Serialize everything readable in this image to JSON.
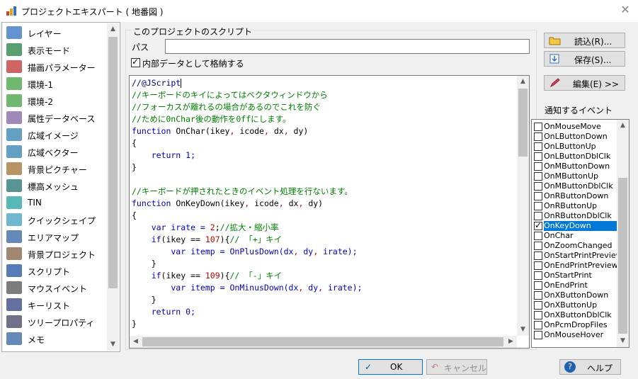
{
  "window": {
    "title": "プロジェクトエキスパート ( 地番図 )",
    "close_glyph": "✕"
  },
  "sidebar": {
    "items": [
      {
        "label": "レイヤー",
        "icon": "layer-icon"
      },
      {
        "label": "表示モード",
        "icon": "display-mode-icon"
      },
      {
        "label": "描画パラメーター",
        "icon": "draw-param-icon"
      },
      {
        "label": "環境-1",
        "icon": "env-icon"
      },
      {
        "label": "環境-2",
        "icon": "env-icon"
      },
      {
        "label": "属性データベース",
        "icon": "attr-db-icon"
      },
      {
        "label": "広域イメージ",
        "icon": "wide-image-icon"
      },
      {
        "label": "広域ベクター",
        "icon": "wide-vector-icon"
      },
      {
        "label": "背景ピクチャー",
        "icon": "bg-picture-icon"
      },
      {
        "label": "標高メッシュ",
        "icon": "elevation-mesh-icon"
      },
      {
        "label": "TIN",
        "icon": "tin-icon"
      },
      {
        "label": "クイックシェイプ",
        "icon": "quick-shape-icon"
      },
      {
        "label": "エリアマップ",
        "icon": "area-map-icon"
      },
      {
        "label": "背景プロジェクト",
        "icon": "bg-project-icon"
      },
      {
        "label": "スクリプト",
        "icon": "script-icon"
      },
      {
        "label": "マウスイベント",
        "icon": "mouse-icon"
      },
      {
        "label": "キーリスト",
        "icon": "key-list-icon"
      },
      {
        "label": "ツリープロパティ",
        "icon": "tree-prop-icon"
      },
      {
        "label": "メモ",
        "icon": "memo-icon"
      }
    ],
    "selected_index": 14
  },
  "script_group": {
    "title": "このプロジェクトのスクリプト",
    "path_label": "パス",
    "path_value": "",
    "store_internal_label": "内部データとして格納する",
    "store_internal_checked": true
  },
  "code_lines": [
    [
      {
        "t": "//@JScript",
        "c": "dark"
      },
      {
        "t": "",
        "c": "caret"
      }
    ],
    [
      {
        "t": "//キーボードのキイによってはベクタウィンドウから",
        "c": "green"
      }
    ],
    [
      {
        "t": "//フォーカスが離れるの場合があるのでこれを防ぐ",
        "c": "green"
      }
    ],
    [
      {
        "t": "//ために0nChar後の動作を0ffにします。",
        "c": "green"
      }
    ],
    [
      {
        "t": "function",
        "c": "blue"
      },
      {
        "t": " OnChar(ikey",
        "c": "black"
      },
      {
        "t": ",",
        "c": "red"
      },
      {
        "t": " icode",
        "c": "black"
      },
      {
        "t": ",",
        "c": "red"
      },
      {
        "t": " dx",
        "c": "black"
      },
      {
        "t": ",",
        "c": "red"
      },
      {
        "t": " dy)",
        "c": "black"
      }
    ],
    [
      {
        "t": "{",
        "c": "black"
      }
    ],
    [
      {
        "t": "    return 1;",
        "c": "blue"
      }
    ],
    [
      {
        "t": "}",
        "c": "black"
      }
    ],
    [
      {
        "t": "",
        "c": "black"
      }
    ],
    [
      {
        "t": "//キーボードが押されたときのイベント処理を行ないます。",
        "c": "green"
      }
    ],
    [
      {
        "t": "function",
        "c": "blue"
      },
      {
        "t": " OnKeyDown(ikey",
        "c": "black"
      },
      {
        "t": ",",
        "c": "red"
      },
      {
        "t": " icode",
        "c": "black"
      },
      {
        "t": ",",
        "c": "red"
      },
      {
        "t": " dx",
        "c": "black"
      },
      {
        "t": ",",
        "c": "red"
      },
      {
        "t": " dy)",
        "c": "black"
      }
    ],
    [
      {
        "t": "{",
        "c": "black"
      }
    ],
    [
      {
        "t": "    var irate = ",
        "c": "blue"
      },
      {
        "t": "2",
        "c": "red"
      },
      {
        "t": ";",
        "c": "black"
      },
      {
        "t": "//拡大・縮小率",
        "c": "green"
      }
    ],
    [
      {
        "t": "    if",
        "c": "blue"
      },
      {
        "t": "(ikey == ",
        "c": "black"
      },
      {
        "t": "107",
        "c": "red"
      },
      {
        "t": "){",
        "c": "black"
      },
      {
        "t": "// 「+」キイ",
        "c": "green"
      }
    ],
    [
      {
        "t": "        var itemp = OnPlusDown(dx",
        "c": "blue"
      },
      {
        "t": ",",
        "c": "red"
      },
      {
        "t": " dy",
        "c": "blue"
      },
      {
        "t": ",",
        "c": "red"
      },
      {
        "t": " irate);",
        "c": "blue"
      }
    ],
    [
      {
        "t": "    }",
        "c": "black"
      }
    ],
    [
      {
        "t": "    if",
        "c": "blue"
      },
      {
        "t": "(ikey == ",
        "c": "black"
      },
      {
        "t": "109",
        "c": "red"
      },
      {
        "t": "){",
        "c": "black"
      },
      {
        "t": "// 「-」キイ",
        "c": "green"
      }
    ],
    [
      {
        "t": "        var itemp = OnMinusDown(dx",
        "c": "blue"
      },
      {
        "t": ",",
        "c": "red"
      },
      {
        "t": " dy",
        "c": "blue"
      },
      {
        "t": ",",
        "c": "red"
      },
      {
        "t": " irate);",
        "c": "blue"
      }
    ],
    [
      {
        "t": "    }",
        "c": "black"
      }
    ],
    [
      {
        "t": "    return 0;",
        "c": "blue"
      }
    ],
    [
      {
        "t": "}",
        "c": "black"
      }
    ]
  ],
  "right_buttons": {
    "load": "読込(R)...",
    "save": "保存(S)...",
    "edit": "編集(E) >>"
  },
  "events": {
    "label": "通知するイベント",
    "items": [
      {
        "label": "OnMouseMove",
        "checked": false
      },
      {
        "label": "OnLButtonDown",
        "checked": false
      },
      {
        "label": "OnLButtonUp",
        "checked": false
      },
      {
        "label": "OnLButtonDblClk",
        "checked": false
      },
      {
        "label": "OnMButtonDown",
        "checked": false
      },
      {
        "label": "OnMButtonUp",
        "checked": false
      },
      {
        "label": "OnMButtonDblClk",
        "checked": false
      },
      {
        "label": "OnRButtonDown",
        "checked": false
      },
      {
        "label": "OnRButtonUp",
        "checked": false
      },
      {
        "label": "OnRButtonDblClk",
        "checked": false
      },
      {
        "label": "OnKeyDown",
        "checked": true
      },
      {
        "label": "OnChar",
        "checked": false
      },
      {
        "label": "OnZoomChanged",
        "checked": false
      },
      {
        "label": "OnStartPrintPreview",
        "checked": false
      },
      {
        "label": "OnEndPrintPreview",
        "checked": false
      },
      {
        "label": "OnStartPrint",
        "checked": false
      },
      {
        "label": "OnEndPrint",
        "checked": false
      },
      {
        "label": "OnXButtonDown",
        "checked": false
      },
      {
        "label": "OnXButtonUp",
        "checked": false
      },
      {
        "label": "OnXButtonDblClk",
        "checked": false
      },
      {
        "label": "OnPcmDropFiles",
        "checked": false
      },
      {
        "label": "OnMouseHover",
        "checked": false
      }
    ],
    "selected_index": 10
  },
  "footer": {
    "ok": "OK",
    "cancel": "キャンセル",
    "help": "ヘルプ"
  },
  "colors": {
    "accent": "#0078d7",
    "comment": "#008000",
    "keyword": "#0000c0",
    "number": "#c00000"
  }
}
